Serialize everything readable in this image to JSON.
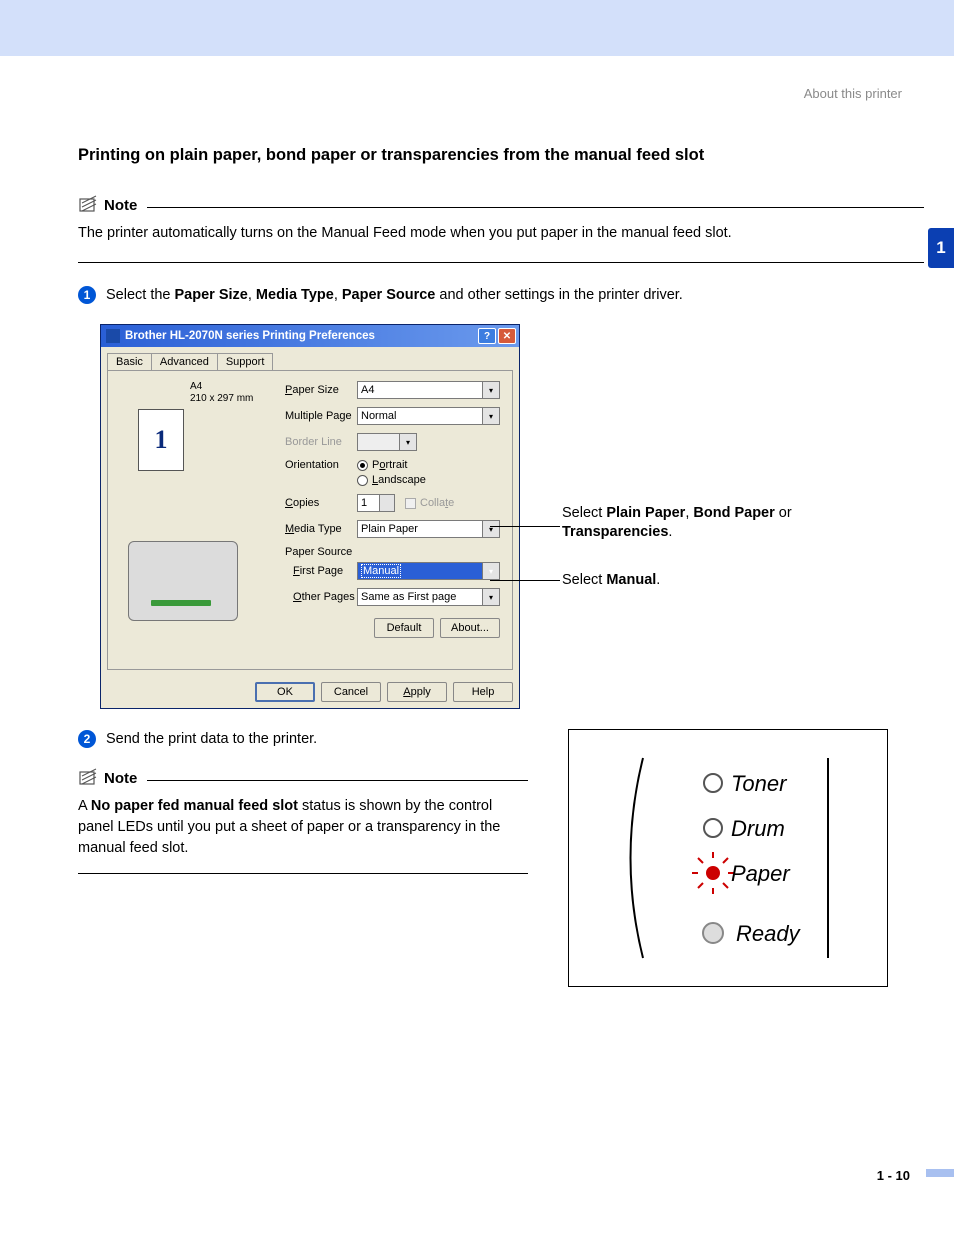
{
  "breadcrumb": "About this printer",
  "chapter_tab": "1",
  "page_number": "1 - 10",
  "section_title": "Printing on plain paper, bond paper or transparencies from the manual feed slot",
  "note1": {
    "label": "Note",
    "body": "The printer automatically turns on the Manual Feed mode when you put paper in the manual feed slot."
  },
  "step1": {
    "num": "1",
    "prefix": "Select the ",
    "b1": "Paper Size",
    "sep1": ", ",
    "b2": "Media Type",
    "sep2": ", ",
    "b3": "Paper Source",
    "suffix": " and other settings in the printer driver."
  },
  "dialog": {
    "title": "Brother HL-2070N series Printing Preferences",
    "tabs": [
      "Basic",
      "Advanced",
      "Support"
    ],
    "paper_name": "A4",
    "paper_dims": "210 x 297 mm",
    "paper_num": "1",
    "labels": {
      "paper_size": "Paper Size",
      "multiple_page": "Multiple Page",
      "border_line": "Border Line",
      "orientation": "Orientation",
      "copies": "Copies",
      "collate": "Collate",
      "media_type": "Media Type",
      "paper_source": "Paper Source",
      "first_page": "First Page",
      "other_pages": "Other Pages"
    },
    "values": {
      "paper_size": "A4",
      "multiple_page": "Normal",
      "border_line": "",
      "portrait": "Portrait",
      "landscape": "Landscape",
      "copies": "1",
      "media_type": "Plain Paper",
      "first_page": "Manual",
      "other_pages": "Same as First page"
    },
    "buttons": {
      "default": "Default",
      "about": "About...",
      "ok": "OK",
      "cancel": "Cancel",
      "apply": "Apply",
      "help": "Help"
    }
  },
  "callouts": {
    "media_pre": "Select ",
    "media_b1": "Plain Paper",
    "media_sep1": ", ",
    "media_b2": "Bond Paper",
    "media_sep2": " or ",
    "media_b3": "Transparencies",
    "media_suffix": ".",
    "source_pre": "Select ",
    "source_b": "Manual",
    "source_suffix": "."
  },
  "step2": {
    "num": "2",
    "text": "Send the print data to the printer."
  },
  "note2": {
    "label": "Note",
    "pre": "A ",
    "bold": "No paper fed manual feed slot",
    "post": " status is shown by the control panel LEDs until you put a sheet of paper or a transparency in the manual feed slot."
  },
  "led": {
    "toner": "Toner",
    "drum": "Drum",
    "paper": "Paper",
    "ready": "Ready"
  }
}
